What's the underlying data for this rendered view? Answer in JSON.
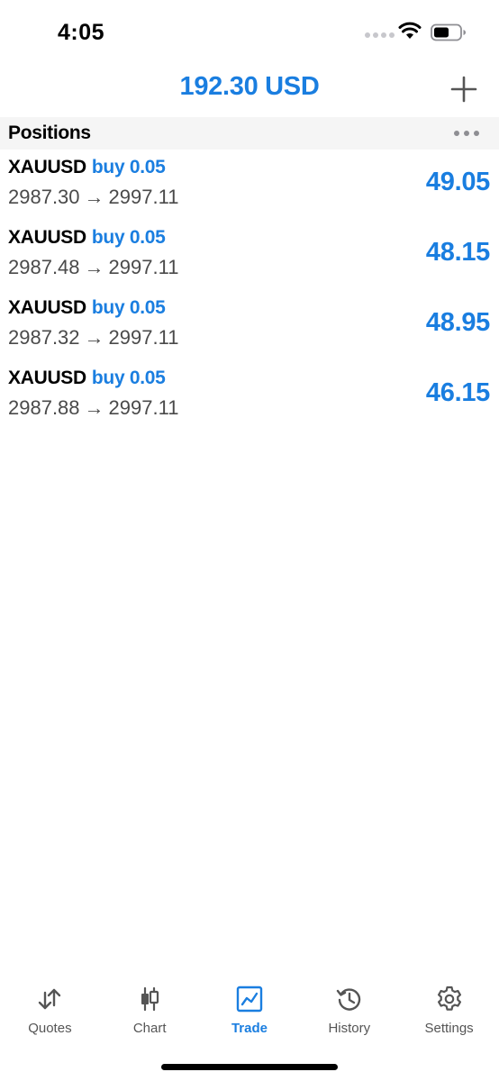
{
  "status_bar": {
    "time": "4:05"
  },
  "header": {
    "balance": "192.30 USD"
  },
  "section": {
    "title": "Positions"
  },
  "positions": [
    {
      "symbol": "XAUUSD",
      "side": "buy 0.05",
      "open_price": "2987.30",
      "arrow": "→",
      "current_price": "2997.11",
      "profit": "49.05"
    },
    {
      "symbol": "XAUUSD",
      "side": "buy 0.05",
      "open_price": "2987.48",
      "arrow": "→",
      "current_price": "2997.11",
      "profit": "48.15"
    },
    {
      "symbol": "XAUUSD",
      "side": "buy 0.05",
      "open_price": "2987.32",
      "arrow": "→",
      "current_price": "2997.11",
      "profit": "48.95"
    },
    {
      "symbol": "XAUUSD",
      "side": "buy 0.05",
      "open_price": "2987.88",
      "arrow": "→",
      "current_price": "2997.11",
      "profit": "46.15"
    }
  ],
  "tabs": [
    {
      "label": "Quotes",
      "icon": "quotes-arrows-icon",
      "active": false
    },
    {
      "label": "Chart",
      "icon": "candlestick-icon",
      "active": false
    },
    {
      "label": "Trade",
      "icon": "trade-chart-icon",
      "active": true
    },
    {
      "label": "History",
      "icon": "history-clock-icon",
      "active": false
    },
    {
      "label": "Settings",
      "icon": "gear-icon",
      "active": false
    }
  ],
  "colors": {
    "accent": "#1a7ee0",
    "section_bg": "#f5f5f5",
    "secondary_text": "#4a4a4a",
    "inactive_tab": "#555555"
  }
}
